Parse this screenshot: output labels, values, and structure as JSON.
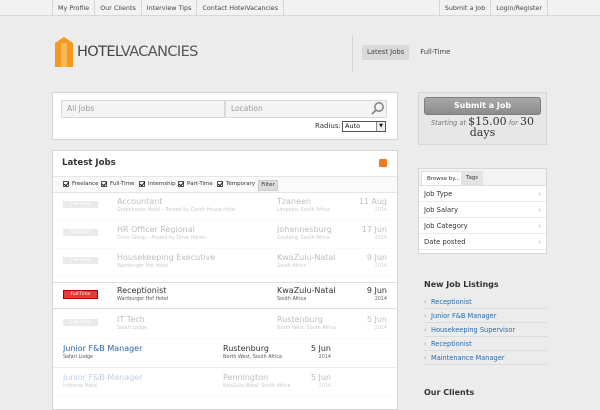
{
  "topnav": {
    "left": [
      "My Profile",
      "Our Clients",
      "Interview Tips",
      "Contact HotelVacancies"
    ],
    "right": [
      "Submit a Job",
      "Login/Register"
    ]
  },
  "logo": {
    "text_a": "HOTEL",
    "text_b": "VACANCIES",
    "icon": "building-icon",
    "color": "#f39a1e"
  },
  "main_tabs": [
    "Latest Jobs",
    "Full-Time"
  ],
  "search": {
    "keywords_placeholder": "All Jobs",
    "location_placeholder": "Location",
    "radius_label": "Radius:",
    "radius_value": "Auto"
  },
  "latest": {
    "title": "Latest Jobs",
    "filters": [
      "Freelance",
      "Full-Time",
      "Internship",
      "Part-Time",
      "Temporary"
    ],
    "filter_button": "Filter",
    "jobs": [
      {
        "badge": "Full-Time",
        "title": "Accountant",
        "company": "Greenhouse Hotel – Posted by Czech House Hotel",
        "loc": "Tzaneen",
        "region": "Limpopo, South Africa",
        "date": "11 Aug",
        "year": "2014"
      },
      {
        "badge": "Full-Time",
        "title": "HR Officer Regional",
        "company": "Drive Group – Posted by Drive Hotels",
        "loc": "Johannesburg",
        "region": "Gauteng, South Africa",
        "date": "17 Jun",
        "year": "2014"
      },
      {
        "badge": "Full-Time",
        "title": "Housekeeping Executive",
        "company": "Wartburger Hof Hotel",
        "loc": "KwaZulu-Natal",
        "region": "South Africa",
        "date": "9 Jun",
        "year": "2014"
      },
      {
        "badge": "Full-Time",
        "title": "Receptionist",
        "company": "Wartburger Hof Hotel",
        "loc": "KwaZulu-Natal",
        "region": "South Africa",
        "date": "9 Jun",
        "year": "2014"
      },
      {
        "badge": "Full-Time",
        "title": "IT Tech",
        "company": "Safari Lodge",
        "loc": "Rustenburg",
        "region": "North West, South Africa",
        "date": "5 Jun",
        "year": "2014"
      },
      {
        "title": "Junior F&B Manager",
        "company": "Safari Lodge",
        "loc": "Rustenburg",
        "region": "North West, South Africa",
        "date": "5 Jun",
        "year": "2014"
      },
      {
        "title": "Junior F&B Manager",
        "company": "Inthorne Hotel",
        "loc": "Pennington",
        "region": "KwaZulu-Natal, South Africa",
        "date": "5 Jun",
        "year": "2014"
      }
    ]
  },
  "submit": {
    "button": "Submit a Job",
    "starting": "Starting at",
    "price": "$15.00",
    "for": "for",
    "days_num": "30",
    "days": "days"
  },
  "browse": {
    "tabs": [
      "Browse by...",
      "Tags"
    ],
    "items": [
      "Job Type",
      "Job Salary",
      "Job Category",
      "Date posted"
    ]
  },
  "new_listings": {
    "title": "New Job Listings",
    "items": [
      "Receptionist",
      "Junior F&B Manager",
      "Housekeeping Supervisor",
      "Receptionist",
      "Maintenance Manager"
    ]
  },
  "clients": {
    "title": "Our Clients"
  },
  "colors": {
    "badge_active": "#e53a3a",
    "link": "#2a6aa8",
    "rss": "#f07b1f"
  }
}
